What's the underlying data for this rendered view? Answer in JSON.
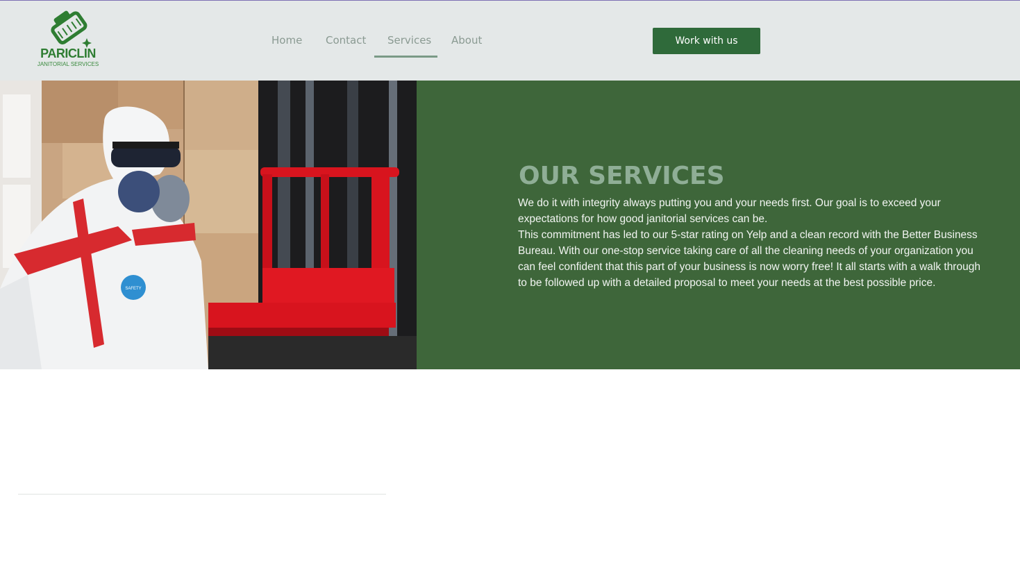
{
  "header": {
    "logo": {
      "name": "PARICLIN",
      "tagline": "JANITORIAL SERVICES"
    },
    "nav": [
      {
        "label": "Home",
        "active": false
      },
      {
        "label": "Contact",
        "active": false
      },
      {
        "label": "Services",
        "active": true
      },
      {
        "label": "About",
        "active": false
      }
    ],
    "cta_label": "Work with us"
  },
  "hero": {
    "image_icon": "worker-in-protective-suit-photo",
    "badge_text": "SAFETY",
    "title": "OUR SERVICES",
    "paragraphs": [
      "We do it with integrity always putting you and your needs first. Our goal is to exceed your expectations for how good janitorial services can be.",
      "This commitment has led to our 5-star rating on Yelp and a clean record with the Better Business Bureau. With our one-stop service taking care of all the cleaning needs of your organization you can feel confident that this part of your business is now worry free! It all starts with a walk through to be followed up with a detailed proposal to meet your needs at the best possible price."
    ]
  },
  "colors": {
    "brand_green": "#2e7d32",
    "panel_green": "#3e663a",
    "header_bg": "#e4e8e8",
    "title_color": "#8fae96",
    "button_bg": "#2f6a3a"
  }
}
